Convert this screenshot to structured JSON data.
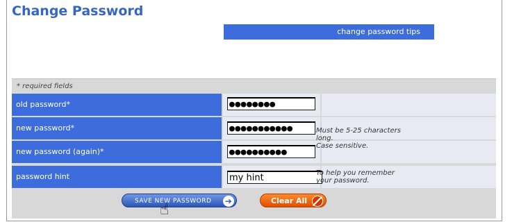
{
  "page": {
    "title": "Change Password",
    "tips_link": "change password tips"
  },
  "form": {
    "required_note": "* required fields",
    "fields": [
      {
        "label": "old password*",
        "value": "●●●●●●●●"
      },
      {
        "label": "new password*",
        "value": "●●●●●●●●●●●"
      },
      {
        "label": "new password (again)*",
        "value": "●●●●●●●●●●"
      },
      {
        "label": "password hint",
        "value": "my hint"
      }
    ],
    "help_new_password": [
      "Must be 5-25 characters",
      "long.",
      "Case sensitive."
    ],
    "help_hint": [
      "To help you remember",
      "your password."
    ]
  },
  "buttons": {
    "save": "SAVE NEW PASSWORD",
    "clear": "Clear All"
  },
  "colors": {
    "row_blue": "#3d6ddc",
    "title_blue": "#3566c3",
    "clear_orange": "#e14e00"
  }
}
